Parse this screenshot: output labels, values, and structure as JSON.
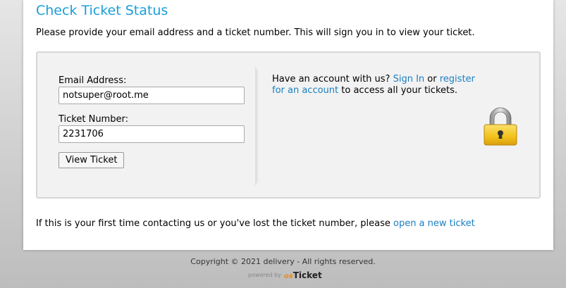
{
  "page": {
    "title": "Check Ticket Status",
    "intro": "Please provide your email address and a ticket number. This will sign you in to view your ticket."
  },
  "form": {
    "email_label": "Email Address:",
    "email_value": "notsuper@root.me",
    "ticket_label": "Ticket Number:",
    "ticket_value": "2231706",
    "submit_label": "View Ticket"
  },
  "account": {
    "prefix": "Have an account with us?",
    "sign_in_link": "Sign In",
    "or_text": "or",
    "register_link": "register for an account",
    "suffix": "to access all your tickets."
  },
  "bottom": {
    "text": "If this is your first time contacting us or you've lost the ticket number, please",
    "new_ticket_link": "open a new ticket"
  },
  "footer": {
    "copyright": "Copyright © 2021 delivery - All rights reserved.",
    "powered_by": "powered by",
    "brand_prefix": "os",
    "brand_name": "Ticket"
  },
  "colors": {
    "title": "#1a9ed8",
    "link": "#1a7fc1",
    "lock": "#f2c21a"
  },
  "icons": [
    "lock-icon",
    "osticket-logo"
  ]
}
